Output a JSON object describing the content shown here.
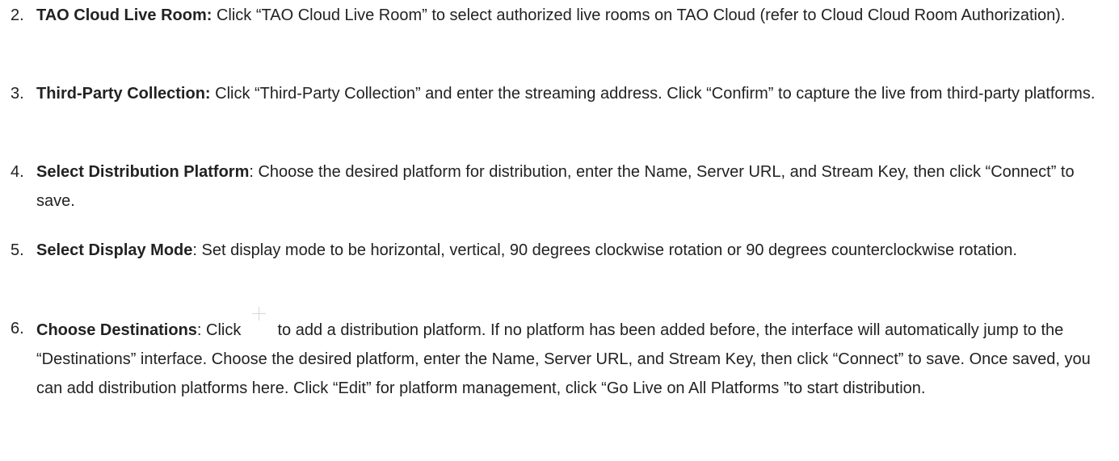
{
  "steps": [
    {
      "number": "2.",
      "title": "TAO Cloud Live Room:",
      "text": " Click “TAO Cloud Live Room” to select authorized live rooms on TAO Cloud (refer to Cloud Cloud Room Authorization)."
    },
    {
      "number": "3.",
      "title": "Third-Party Collection:",
      "text": " Click “Third-Party Collection” and enter the streaming address. Click “Confirm” to capture the live from third-party platforms."
    },
    {
      "number": "4.",
      "title": "Select Distribution Platform",
      "text": ": Choose the desired platform for distribution, enter the Name, Server URL, and Stream Key, then click “Connect” to save."
    },
    {
      "number": "5.",
      "title": "Select Display Mode",
      "text": ": Set display mode to be horizontal, vertical, 90 degrees clockwise rotation or 90 degrees counterclockwise rotation."
    },
    {
      "number": "6.",
      "title": "Choose Destinations",
      "text_before_icon": ": Click ",
      "icon": "plus-icon",
      "text_after_icon": " to add a distribution platform. If no platform has been added before, the interface will automatically jump to the “Destinations” interface. Choose the desired platform, enter the Name, Server URL, and Stream Key, then click “Connect” to save. Once saved, you can add distribution platforms here. Click “Edit” for platform management, click “Go Live on All Platforms ”to start distribution."
    }
  ]
}
